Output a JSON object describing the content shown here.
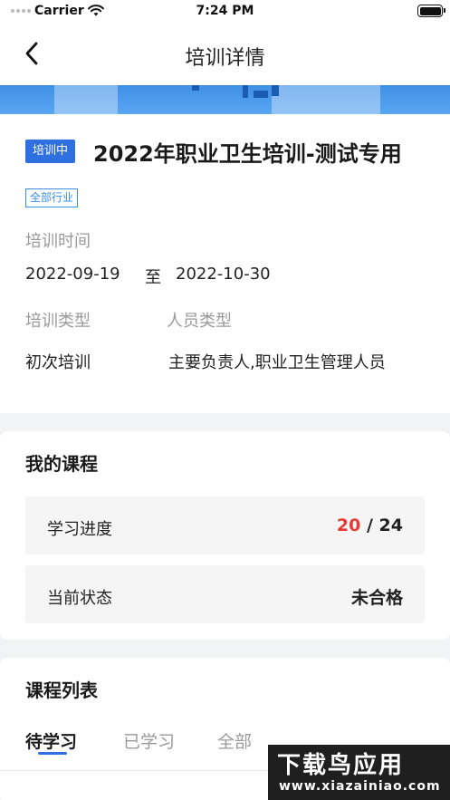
{
  "status_bar": {
    "carrier": "Carrier",
    "time": "7:24 PM"
  },
  "nav": {
    "title": "培训详情"
  },
  "training": {
    "status_tag": "培训中",
    "title": "2022年职业卫生培训-测试专用",
    "industry_tag": "全部行业",
    "time_label": "培训时间",
    "start_date": "2022-09-19",
    "date_separator": "至",
    "end_date": "2022-10-30",
    "type_label": "培训类型",
    "type_value": "初次培训",
    "personnel_label": "人员类型",
    "personnel_value": "主要负责人,职业卫生管理人员"
  },
  "my_course": {
    "title": "我的课程",
    "progress_label": "学习进度",
    "progress_done": "20",
    "progress_sep": "/",
    "progress_total": "24",
    "state_label": "当前状态",
    "state_value": "未合格"
  },
  "course_list": {
    "title": "课程列表",
    "tabs": [
      "待学习",
      "已学习",
      "全部"
    ],
    "partial_item": "…"
  },
  "watermark": {
    "line1": "下载鸟应用",
    "line2": "www.xiazainiao.com"
  },
  "colors": {
    "accent": "#2f6fe0",
    "alert": "#e53935",
    "industry": "#3a8ee6"
  }
}
